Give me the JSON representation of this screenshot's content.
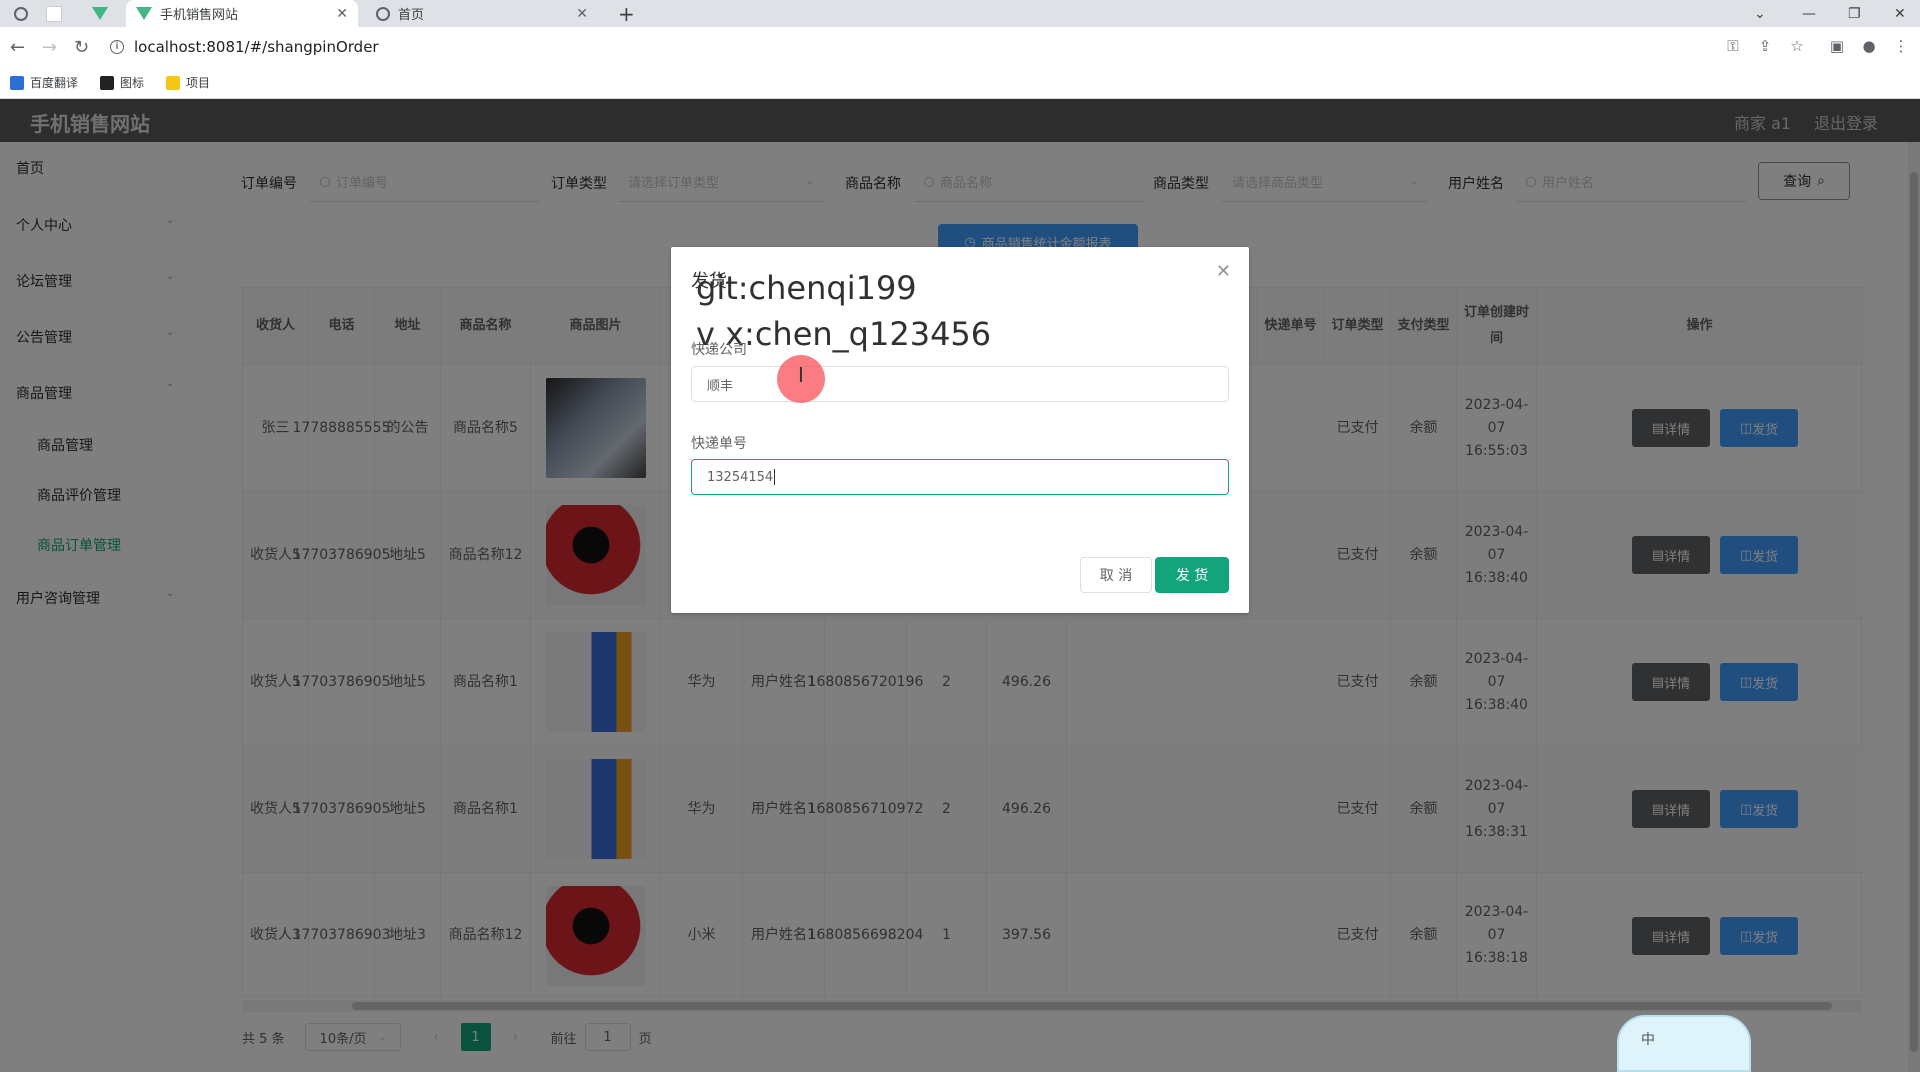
{
  "browser": {
    "tabs": [
      {
        "title": "手机销售网站",
        "active": true
      },
      {
        "title": "首页",
        "active": false
      }
    ],
    "url": "localhost:8081/#/shangpinOrder",
    "bookmarks": [
      "百度翻译",
      "图标",
      "项目"
    ]
  },
  "header": {
    "brand": "手机销售网站",
    "user": "商家 a1",
    "logout": "退出登录"
  },
  "sidebar": {
    "items": [
      {
        "label": "首页"
      },
      {
        "label": "个人中心"
      },
      {
        "label": "论坛管理"
      },
      {
        "label": "公告管理"
      },
      {
        "label": "商品管理"
      },
      {
        "label": "商品管理"
      },
      {
        "label": "商品评价管理"
      },
      {
        "label": "商品订单管理"
      },
      {
        "label": "用户咨询管理"
      }
    ]
  },
  "search": {
    "order_no_label": "订单编号",
    "order_no_placeholder": "订单编号",
    "order_type_label": "订单类型",
    "order_type_placeholder": "请选择订单类型",
    "product_name_label": "商品名称",
    "product_name_placeholder": "商品名称",
    "product_type_label": "商品类型",
    "product_type_placeholder": "请选择商品类型",
    "user_name_label": "用户姓名",
    "user_name_placeholder": "用户姓名",
    "query_button": "查询",
    "stats_button": "商品销售统计金额报表"
  },
  "table": {
    "headers": {
      "receiver": "收货人",
      "phone": "电话",
      "address": "地址",
      "product_name": "商品名称",
      "product_image": "商品图片",
      "express_no": "快递单号",
      "order_type": "订单类型",
      "pay_type": "支付类型",
      "created": "订单创建时间",
      "actions": "操作"
    },
    "rows": [
      {
        "receiver": "张三",
        "phone": "17788885555",
        "address": "的公告",
        "product": "商品名称5",
        "brand": "",
        "user": "",
        "order_no": "",
        "qty": "",
        "price": "",
        "order_type": "已支付",
        "pay_type": "余额",
        "created": "2023-04-07 16:55:03"
      },
      {
        "receiver": "收货人5",
        "phone": "17703786905",
        "address": "地址5",
        "product": "商品名称12",
        "brand": "",
        "user": "",
        "order_no": "",
        "qty": "",
        "price": "",
        "order_type": "已支付",
        "pay_type": "余额",
        "created": "2023-04-07 16:38:40"
      },
      {
        "receiver": "收货人5",
        "phone": "17703786905",
        "address": "地址5",
        "product": "商品名称1",
        "brand": "华为",
        "user": "用户姓名1",
        "order_no": "1680856720196",
        "qty": "2",
        "price": "496.26",
        "order_type": "已支付",
        "pay_type": "余额",
        "created": "2023-04-07 16:38:40"
      },
      {
        "receiver": "收货人5",
        "phone": "17703786905",
        "address": "地址5",
        "product": "商品名称1",
        "brand": "华为",
        "user": "用户姓名1",
        "order_no": "1680856710972",
        "qty": "2",
        "price": "496.26",
        "order_type": "已支付",
        "pay_type": "余额",
        "created": "2023-04-07 16:38:31"
      },
      {
        "receiver": "收货人3",
        "phone": "17703786903",
        "address": "地址3",
        "product": "商品名称12",
        "brand": "小米",
        "user": "用户姓名1",
        "order_no": "1680856698204",
        "qty": "1",
        "price": "397.56",
        "order_type": "已支付",
        "pay_type": "余额",
        "created": "2023-04-07 16:38:18"
      }
    ],
    "detail_button": "详情",
    "ship_button": "发货"
  },
  "pagination": {
    "total": "共 5 条",
    "page_size": "10条/页",
    "current": "1",
    "goto_prefix": "前往",
    "goto_value": "1",
    "goto_suffix": "页"
  },
  "dialog": {
    "title": "发货",
    "watermark_line1": "git:chenqi199",
    "watermark_line2": "v x:chen_q123456",
    "company_label": "快递公司",
    "company_value": "顺丰",
    "tracking_label": "快递单号",
    "tracking_value": "13254154",
    "cancel": "取 消",
    "confirm": "发 货"
  },
  "ime": {
    "label": "中"
  },
  "colors": {
    "primary": "#13a47c",
    "blue": "#409eff",
    "header": "#5a5a5a"
  }
}
